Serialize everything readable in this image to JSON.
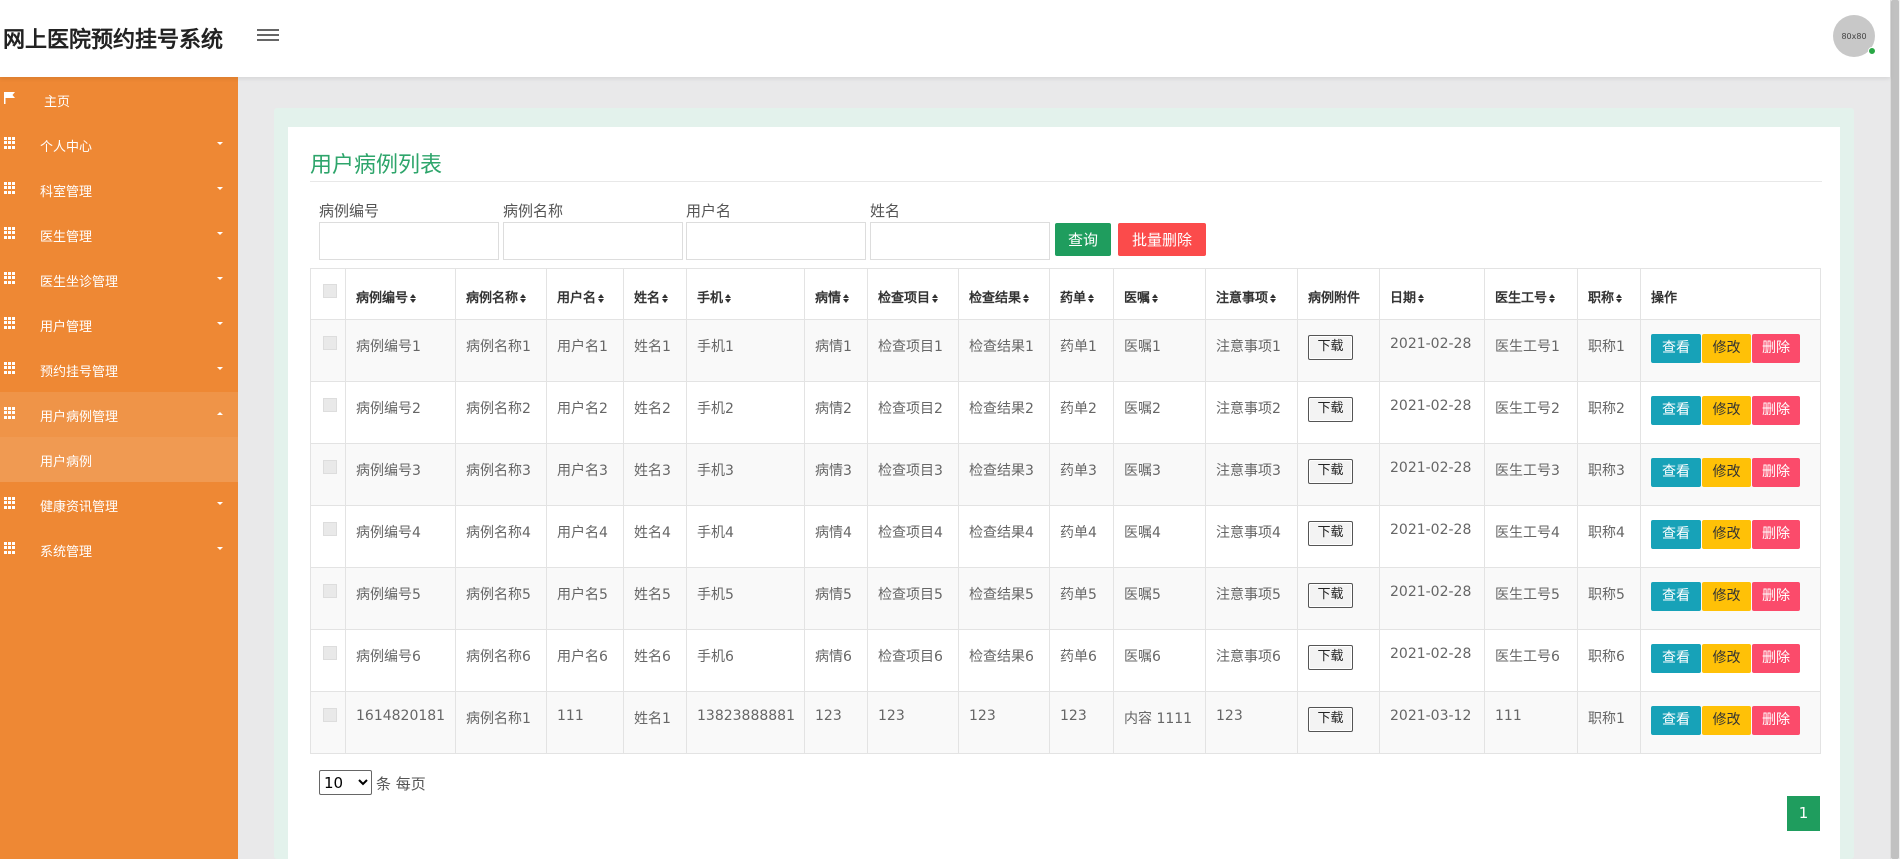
{
  "header": {
    "app_title": "网上医院预约挂号系统",
    "avatar_text": "80x80"
  },
  "sidebar": {
    "items": [
      {
        "label": "主页",
        "icon": "flag-icon"
      },
      {
        "label": "个人中心",
        "icon": "grid-icon"
      },
      {
        "label": "科室管理",
        "icon": "grid-icon"
      },
      {
        "label": "医生管理",
        "icon": "grid-icon"
      },
      {
        "label": "医生坐诊管理",
        "icon": "grid-icon"
      },
      {
        "label": "用户管理",
        "icon": "grid-icon"
      },
      {
        "label": "预约挂号管理",
        "icon": "grid-icon"
      },
      {
        "label": "用户病例管理",
        "icon": "grid-icon"
      },
      {
        "label": "健康资讯管理",
        "icon": "grid-icon"
      },
      {
        "label": "系统管理",
        "icon": "grid-icon"
      }
    ],
    "sub_item": "用户病例"
  },
  "main": {
    "title": "用户病例列表",
    "filters": {
      "case_no_label": "病例编号",
      "case_name_label": "病例名称",
      "username_label": "用户名",
      "name_label": "姓名",
      "case_no_value": "",
      "case_name_value": "",
      "username_value": "",
      "name_value": ""
    },
    "query_button": "查询",
    "batch_delete_button": "批量删除",
    "table": {
      "headers": [
        "病例编号",
        "病例名称",
        "用户名",
        "姓名",
        "手机",
        "病情",
        "检查项目",
        "检查结果",
        "药单",
        "医嘱",
        "注意事项",
        "病例附件",
        "日期",
        "医生工号",
        "职称",
        "操作"
      ],
      "download_label": "下载",
      "view_label": "查看",
      "edit_label": "修改",
      "delete_label": "删除",
      "rows": [
        [
          "病例编号1",
          "病例名称1",
          "用户名1",
          "姓名1",
          "手机1",
          "病情1",
          "检查项目1",
          "检查结果1",
          "药单1",
          "医嘱1",
          "注意事项1",
          "2021-02-28",
          "医生工号1",
          "职称1"
        ],
        [
          "病例编号2",
          "病例名称2",
          "用户名2",
          "姓名2",
          "手机2",
          "病情2",
          "检查项目2",
          "检查结果2",
          "药单2",
          "医嘱2",
          "注意事项2",
          "2021-02-28",
          "医生工号2",
          "职称2"
        ],
        [
          "病例编号3",
          "病例名称3",
          "用户名3",
          "姓名3",
          "手机3",
          "病情3",
          "检查项目3",
          "检查结果3",
          "药单3",
          "医嘱3",
          "注意事项3",
          "2021-02-28",
          "医生工号3",
          "职称3"
        ],
        [
          "病例编号4",
          "病例名称4",
          "用户名4",
          "姓名4",
          "手机4",
          "病情4",
          "检查项目4",
          "检查结果4",
          "药单4",
          "医嘱4",
          "注意事项4",
          "2021-02-28",
          "医生工号4",
          "职称4"
        ],
        [
          "病例编号5",
          "病例名称5",
          "用户名5",
          "姓名5",
          "手机5",
          "病情5",
          "检查项目5",
          "检查结果5",
          "药单5",
          "医嘱5",
          "注意事项5",
          "2021-02-28",
          "医生工号5",
          "职称5"
        ],
        [
          "病例编号6",
          "病例名称6",
          "用户名6",
          "姓名6",
          "手机6",
          "病情6",
          "检查项目6",
          "检查结果6",
          "药单6",
          "医嘱6",
          "注意事项6",
          "2021-02-28",
          "医生工号6",
          "职称6"
        ],
        [
          "1614820181",
          "病例名称1",
          "111",
          "姓名1",
          "13823888881",
          "123",
          "123",
          "123",
          "123",
          "内容 1111",
          "123",
          "2021-03-12",
          "111",
          "职称1"
        ]
      ]
    },
    "page_size": "10",
    "page_size_options": [
      "10"
    ],
    "per_page_label": "条 每页",
    "current_page": "1"
  },
  "colors": {
    "sidebar": "#ee8834",
    "accent_green": "#1f9d5e",
    "title_green": "#2ea56b",
    "danger": "#fb4b4b",
    "info": "#17a2b8",
    "warning": "#ffc107"
  }
}
